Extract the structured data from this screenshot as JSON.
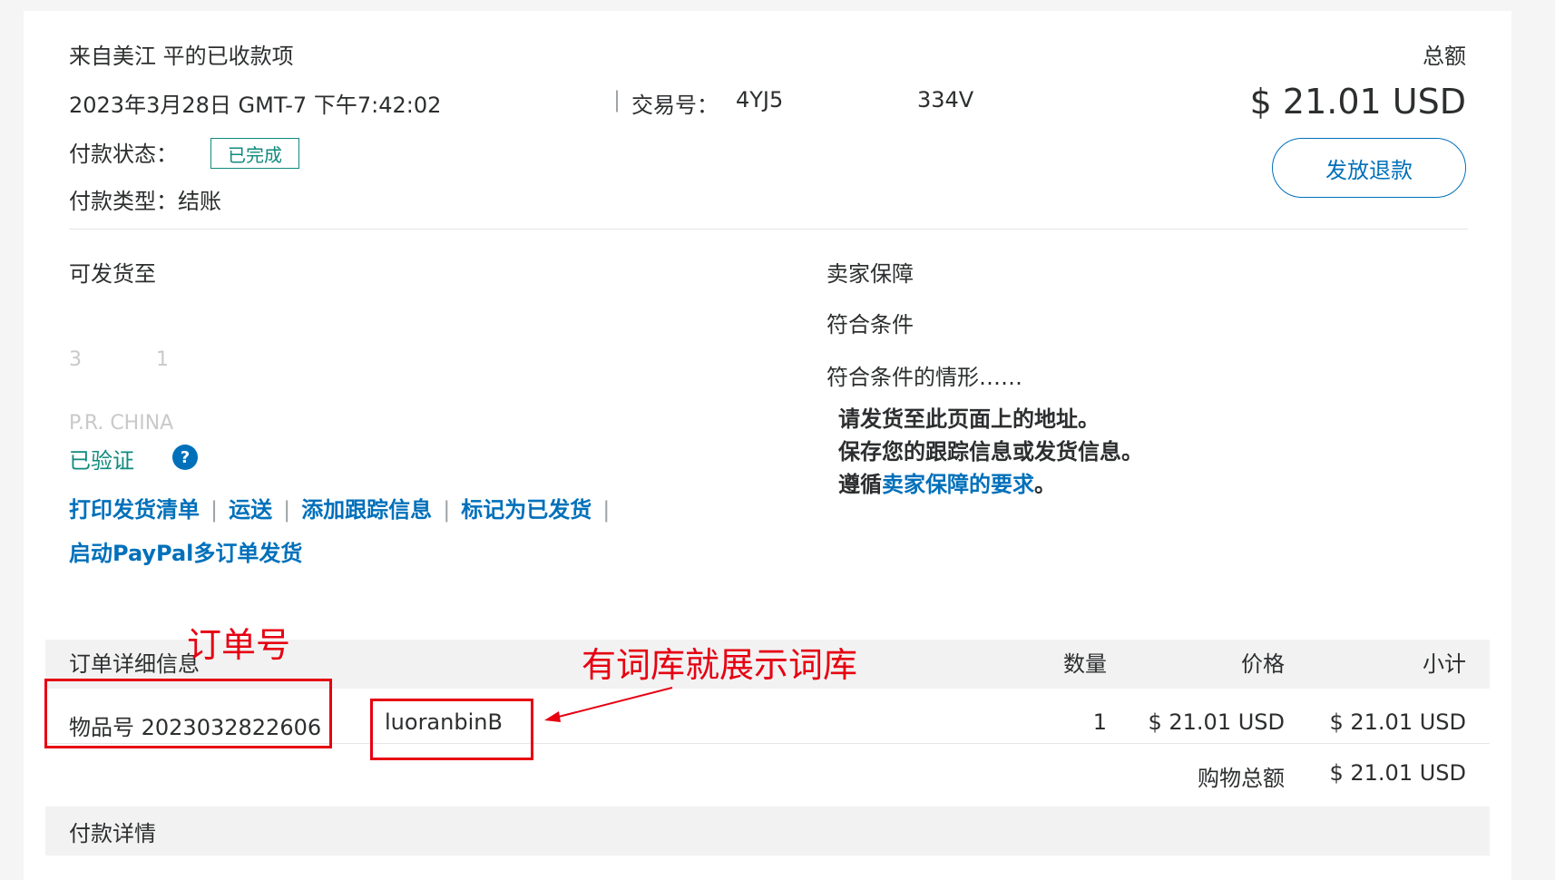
{
  "header": {
    "title": "来自美江 平的已收款项",
    "datetime": "2023年3月28日 GMT-7 下午7:42:02",
    "separator": "|",
    "transaction_label": "交易号：",
    "transaction_id_visible_start": "4YJ5",
    "transaction_id_visible_end": "334V",
    "total_label": "总额",
    "total_amount": "$ 21.01 USD",
    "refund_button": "发放退款",
    "status_label": "付款状态：",
    "status_value": "已完成",
    "type_label": "付款类型：",
    "type_value": "结账"
  },
  "shipping": {
    "title": "可发货至",
    "address_line_2": "3",
    "address_line_2b": "1",
    "address_country": "P.R. CHINA",
    "verified": "已验证",
    "help_icon_glyph": "?",
    "actions": [
      "打印发货清单",
      "运送",
      "添加跟踪信息",
      "标记为已发货"
    ],
    "action_separator": "|",
    "multi_order": "启动PayPal多订单发货"
  },
  "protection": {
    "title": "卖家保障",
    "eligibility": "符合条件",
    "condition": "符合条件的情形……",
    "bullets": [
      "请发货至此页面上的地址。",
      "保存您的跟踪信息或发货信息。"
    ],
    "bullet3_prefix": "遵循",
    "bullet3_link": "卖家保障的要求",
    "bullet3_suffix": "。"
  },
  "order": {
    "section_title": "订单详细信息",
    "col_qty": "数量",
    "col_price": "价格",
    "col_subtotal": "小计",
    "item_label": "物品号 2023032822606",
    "item_name": "luoranbinB",
    "qty": "1",
    "price": "$ 21.01 USD",
    "subtotal": "$ 21.01 USD",
    "cart_total_label": "购物总额",
    "cart_total": "$ 21.01 USD"
  },
  "payment": {
    "section_title": "付款详情"
  },
  "annotations": {
    "order_number": "订单号",
    "dictionary": "有词库就展示词库"
  },
  "colors": {
    "link_blue": "#0070ba",
    "verified_green": "#118a7e",
    "annotation_red": "#e60012"
  }
}
